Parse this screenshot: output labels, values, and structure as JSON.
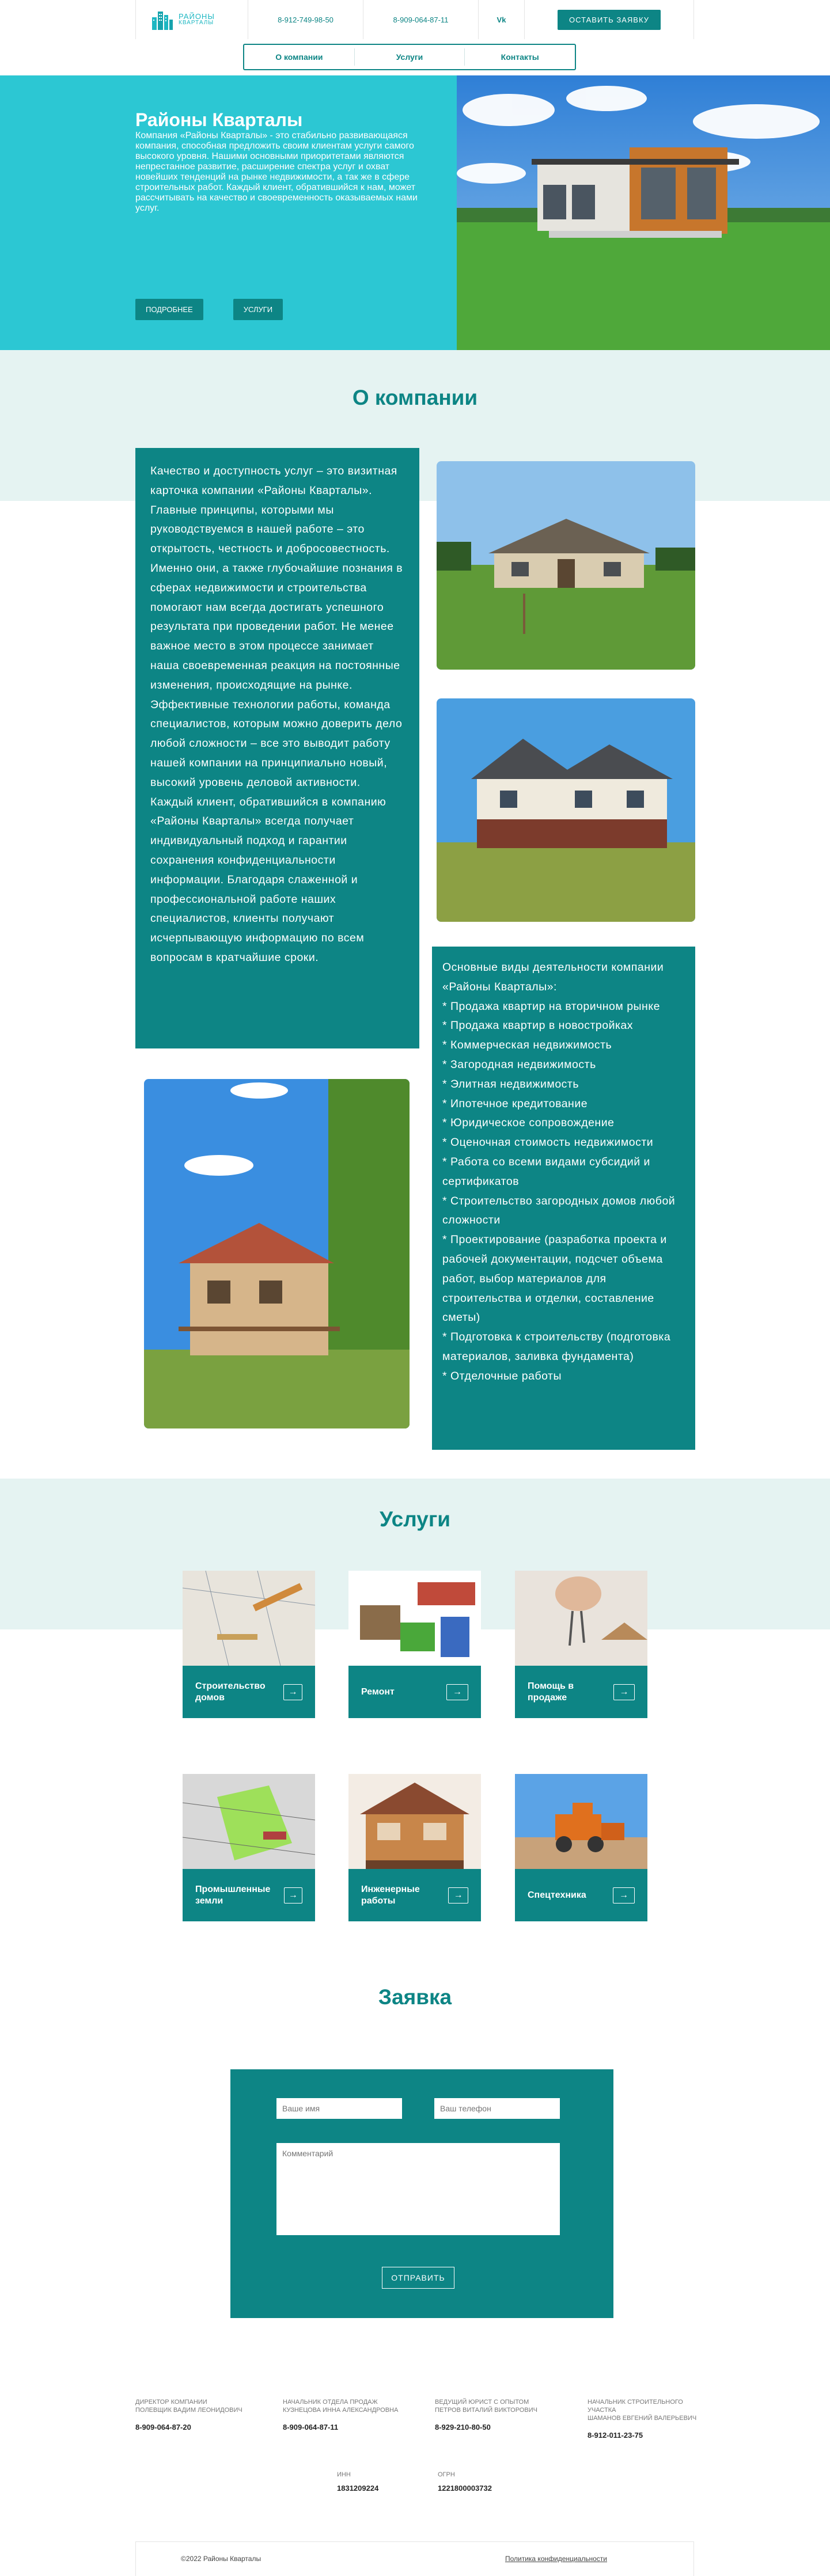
{
  "header": {
    "logo_line1": "РАЙОНЫ",
    "logo_line2": "КВАРТАЛЫ",
    "phone1": "8-912-749-98-50",
    "phone2": "8-909-064-87-11",
    "vk": "Vk",
    "cta": "ОСТАВИТЬ ЗАЯВКУ"
  },
  "nav": [
    "О компании",
    "Услуги",
    "Контакты"
  ],
  "hero": {
    "title": "Районы Кварталы",
    "text": "Компания «Районы Кварталы» - это стабильно развивающаяся компания, способная предложить своим клиентам услуги самого высокого уровня. Нашими основными приоритетами являются непрестанное развитие, расширение спектра услуг и охват новейших тенденций на рынке недвижимости, а так же в сфере строительных работ. Каждый клиент, обратившийся к нам, может рассчитывать на качество и своевременность оказываемых нами услуг.",
    "btn_more": "ПОДРОБНЕЕ",
    "btn_services": "УСЛУГИ"
  },
  "about": {
    "title": "О компании",
    "text1": "Качество и доступность услуг – это визитная карточка компании «Районы Кварталы». Главные принципы, которыми мы руководствуемся в нашей работе – это открытость, честность и добросовестность. Именно они, а также глубочайшие познания в сферах недвижимости и строительства помогают нам всегда достигать успешного результата при проведении работ. Не менее важное место в этом процессе занимает наша своевременная реакция на постоянные изменения, происходящие на рынке. Эффективные технологии работы, команда специалистов, которым можно доверить дело любой сложности – все это выводит работу нашей компании на принципиально новый, высокий уровень деловой активности.",
    "text2": "Каждый клиент, обратившийся в компанию «Районы Кварталы» всегда получает индивидуальный подход и гарантии сохранения конфиденциальности информации. Благодаря слаженной и профессиональной работе наших специалистов, клиенты получают исчерпывающую информацию по всем вопросам в кратчайшие сроки.",
    "list_title": "Основные виды деятельности компании  «Районы Кварталы»:",
    "list": [
      "* Продажа квартир на вторичном рынке",
      "* Продажа квартир в новостройках",
      "* Коммерческая недвижимость",
      "* Загородная недвижимость",
      "* Элитная недвижимость",
      "* Ипотечное кредитование",
      "* Юридическое сопровождение",
      "* Оценочная стоимость недвижимости",
      "* Работа со всеми видами субсидий и сертификатов",
      "* Строительство загородных домов любой сложности",
      "* Проектирование (разработка проекта и рабочей документации, подсчет объема работ, выбор материалов для строительства и отделки, составление сметы)",
      "* Подготовка к строительству (подготовка материалов, заливка фундамента)",
      "* Отделочные работы"
    ]
  },
  "services": {
    "title": "Услуги",
    "items": [
      {
        "label": "Строительство домов",
        "icon": "blueprint-photo"
      },
      {
        "label": "Ремонт",
        "icon": "tools-photo"
      },
      {
        "label": "Помощь в продаже",
        "icon": "keys-photo"
      },
      {
        "label": "Промышленные земли",
        "icon": "land-plan-photo"
      },
      {
        "label": "Инженерные работы",
        "icon": "house-cutaway-photo"
      },
      {
        "label": "Спецтехника",
        "icon": "bulldozer-photo"
      }
    ],
    "arrow": "→"
  },
  "form": {
    "title": "Заявка",
    "name_placeholder": "Ваше имя",
    "phone_placeholder": "Ваш телефон",
    "comment_placeholder": "Комментарий",
    "submit": "ОТПРАВИТЬ"
  },
  "footer": {
    "contacts": [
      {
        "role": "ДИРЕКТОР КОМПАНИИ",
        "name": "ПОЛЕВЩИК ВАДИМ ЛЕОНИДОВИЧ",
        "phone": "8-909-064-87-20"
      },
      {
        "role": "НАЧАЛЬНИК ОТДЕЛА ПРОДАЖ",
        "name": "КУЗНЕЦОВА ИННА АЛЕКСАНДРОВНА",
        "phone": "8-909-064-87-11"
      },
      {
        "role": "ВЕДУЩИЙ ЮРИСТ С ОПЫТОМ",
        "name": "ПЕТРОВ ВИТАЛИЙ ВИКТОРОВИЧ",
        "phone": "8-929-210-80-50"
      },
      {
        "role": "НАЧАЛЬНИК СТРОИТЕЛЬНОГО УЧАСТКА",
        "name": "ШАМАНОВ ЕВГЕНИЙ ВАЛЕРЬЕВИЧ",
        "phone": "8-912-011-23-75"
      }
    ],
    "inn_label": "ИНН",
    "inn": "1831209224",
    "ogrn_label": "ОГРН",
    "ogrn": "1221800003732",
    "copyright": "©2022 Районы Кварталы",
    "policy": "Политика конфиденциальности"
  }
}
